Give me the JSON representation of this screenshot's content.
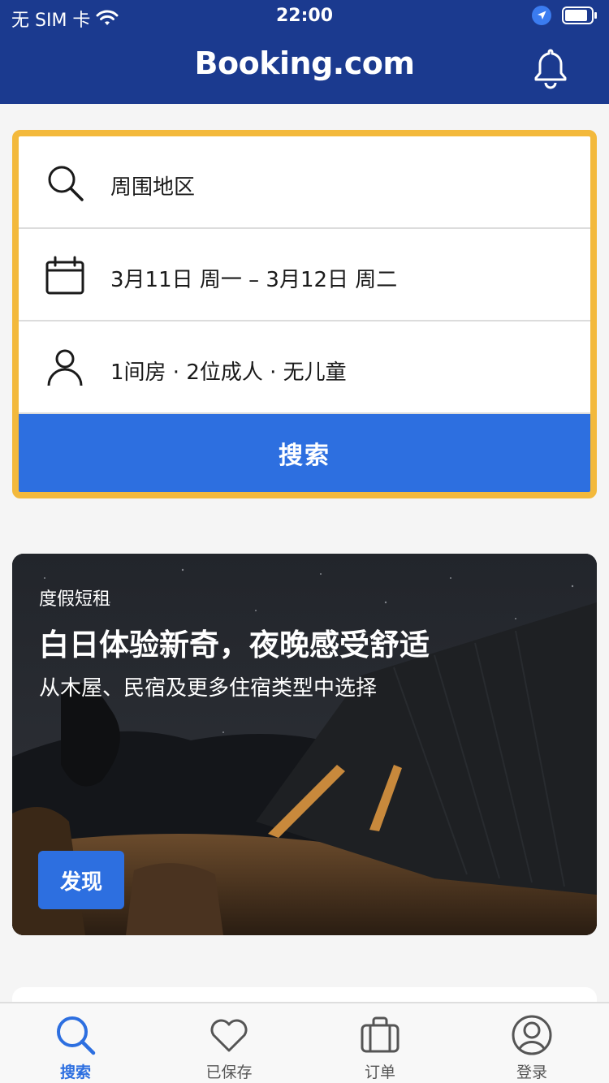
{
  "status_bar": {
    "carrier": "无 SIM 卡",
    "time": "22:00"
  },
  "header": {
    "brand": "Booking.com"
  },
  "search": {
    "destination": "周围地区",
    "dates": "3月11日 周一  –  3月12日 周二",
    "guests": "1间房 · 2位成人 · 无儿童",
    "button_label": "搜索"
  },
  "promo": {
    "eyebrow": "度假短租",
    "headline": "白日体验新奇，夜晚感受舒适",
    "subtitle": "从木屋、民宿及更多住宿类型中选择",
    "cta": "发现"
  },
  "tabs": [
    {
      "label": "搜索",
      "icon": "search-icon",
      "active": true
    },
    {
      "label": "已保存",
      "icon": "heart-icon",
      "active": false
    },
    {
      "label": "订单",
      "icon": "briefcase-icon",
      "active": false
    },
    {
      "label": "登录",
      "icon": "user-circle-icon",
      "active": false
    }
  ],
  "colors": {
    "header_bg": "#1b3a8f",
    "accent": "#2d6fe0",
    "card_border": "#f3b93c"
  }
}
